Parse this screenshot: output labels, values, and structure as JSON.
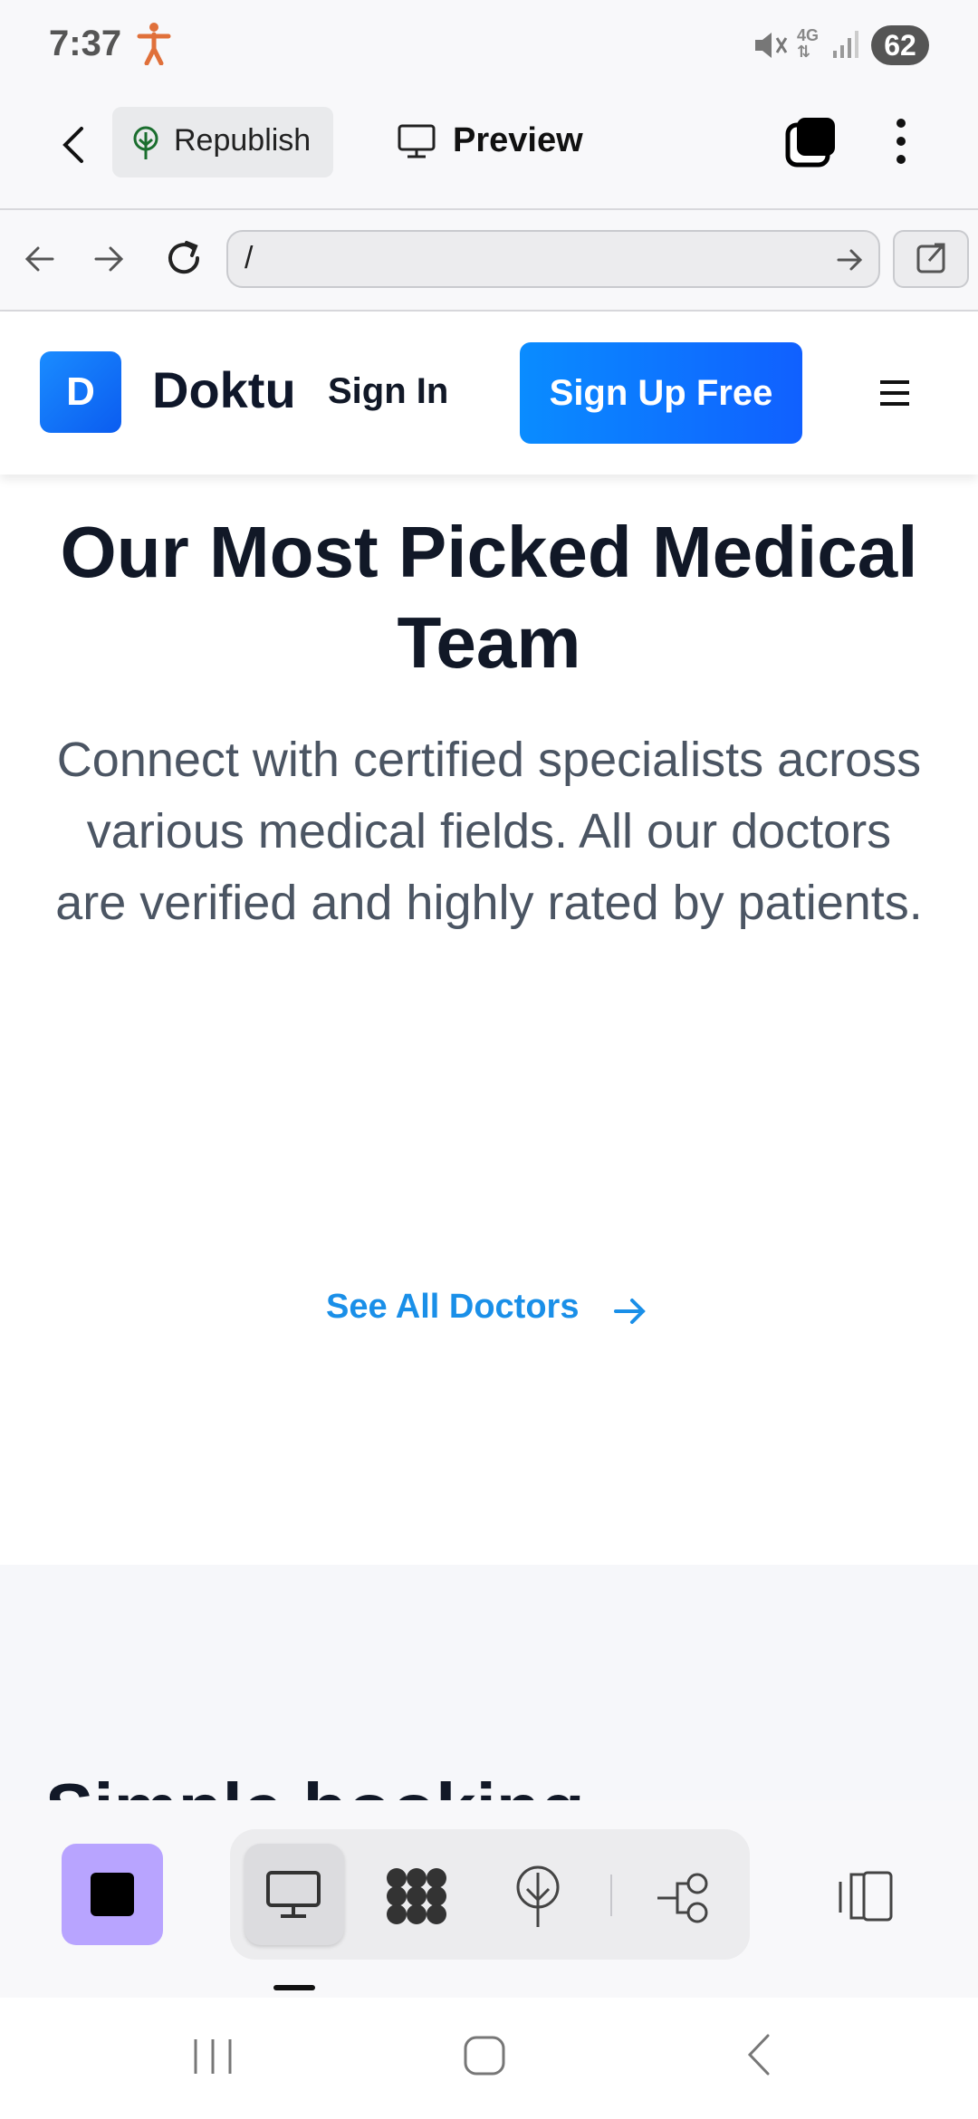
{
  "status_bar": {
    "time": "7:37",
    "network": "4G",
    "battery": "62",
    "icons": [
      "accessibility-icon",
      "mute-icon",
      "signal-icon"
    ]
  },
  "app_toolbar": {
    "republish_label": "Republish",
    "preview_label": "Preview",
    "icons": [
      "back-arrow-icon",
      "tabs-icon",
      "more-vert-icon"
    ]
  },
  "browser_bar": {
    "url_value": "/",
    "icons": [
      "nav-back-icon",
      "nav-forward-icon",
      "reload-icon",
      "go-arrow-icon",
      "open-external-icon"
    ]
  },
  "site_header": {
    "logo_letter": "D",
    "brand": "Doktu",
    "signin_label": "Sign In",
    "signup_label": "Sign Up Free",
    "accent_color": "#0b6cff"
  },
  "main": {
    "headline": "Our Most Picked Medical Team",
    "subtext": "Connect with certified specialists across various medical fields. All our doctors are verified and highly rated by patients.",
    "see_all_label": "See All Doctors",
    "link_color": "#1a8fe8"
  },
  "section2": {
    "title_partial": "Simple booking"
  },
  "bottom_bar": {
    "stop_color": "#b8a4ff",
    "icons": [
      "stop-icon",
      "desktop-icon",
      "blocks-icon",
      "publish-icon",
      "flow-icon",
      "panel-icon"
    ]
  },
  "system_nav": {
    "icons": [
      "recents-icon",
      "home-icon",
      "back-icon"
    ]
  }
}
